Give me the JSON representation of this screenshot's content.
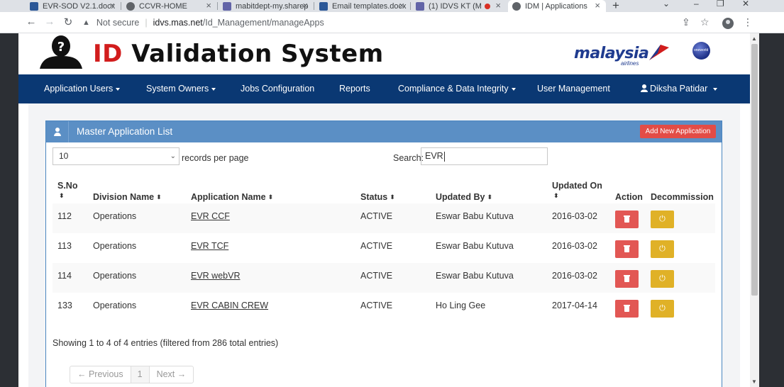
{
  "browser": {
    "tabs": [
      {
        "title": "EVR-SOD V2.1.docx",
        "favicon_color": "#2b5797"
      },
      {
        "title": "CCVR-HOME",
        "favicon_color": "#5f6368"
      },
      {
        "title": "mabitdept-my.sharep",
        "favicon_color": "#6264a7"
      },
      {
        "title": "Email templates.docx",
        "favicon_color": "#2b5797"
      },
      {
        "title": "(1) IDVS KT (M",
        "favicon_color": "#6264a7"
      },
      {
        "title": "IDM | Applications",
        "favicon_color": "#5f6368"
      }
    ],
    "new_tab": "+",
    "nav": {
      "back": "←",
      "forward": "→",
      "reload": "↻"
    },
    "security_warning": "▲",
    "not_secure": "Not secure",
    "url_host": "idvs.mas.net",
    "url_path": "/Id_Management/manageApps"
  },
  "header": {
    "title_id": "ID",
    "title_rest": " Validation System",
    "airline_word": "malaysia",
    "airline_sub": "airlines",
    "alliance": "oneworld"
  },
  "nav": {
    "items": [
      {
        "label": "Application Users",
        "dropdown": true
      },
      {
        "label": "System Owners",
        "dropdown": true
      },
      {
        "label": "Jobs Configuration",
        "dropdown": false
      },
      {
        "label": "Reports",
        "dropdown": false
      },
      {
        "label": "Compliance & Data Integrity",
        "dropdown": true
      },
      {
        "label": "User Management",
        "dropdown": false
      }
    ],
    "user": "Diksha Patidar"
  },
  "panel": {
    "title": "Master Application List",
    "add_button": "Add New Application",
    "page_length": "10",
    "records_per_page": "records per page",
    "search_label": "Search:",
    "search_value": "EVR",
    "columns": {
      "sno": "S.No",
      "division": "Division Name",
      "application": "Application Name",
      "status": "Status",
      "updated_by": "Updated By",
      "updated_on": "Updated On",
      "action": "Action",
      "decommission": "Decommission"
    },
    "rows": [
      {
        "sno": "112",
        "division": "Operations",
        "application": "EVR CCF",
        "status": "ACTIVE",
        "updated_by": "Eswar Babu Kutuva",
        "updated_on": "2016-03-02"
      },
      {
        "sno": "113",
        "division": "Operations",
        "application": "EVR TCF",
        "status": "ACTIVE",
        "updated_by": "Eswar Babu Kutuva",
        "updated_on": "2016-03-02"
      },
      {
        "sno": "114",
        "division": "Operations",
        "application": "EVR webVR",
        "status": "ACTIVE",
        "updated_by": "Eswar Babu Kutuva",
        "updated_on": "2016-03-02"
      },
      {
        "sno": "133",
        "division": "Operations",
        "application": "EVR CABIN CREW",
        "status": "ACTIVE",
        "updated_by": "Ho Ling Gee",
        "updated_on": "2017-04-14"
      }
    ],
    "info": "Showing 1 to 4 of 4 entries (filtered from 286 total entries)",
    "pager": {
      "previous": "← Previous",
      "page": "1",
      "next": "Next →"
    }
  },
  "colors": {
    "nav_bg": "#0a3873",
    "panel_head": "#5b8fc5",
    "danger": "#e25754",
    "warning": "#e0b127"
  }
}
